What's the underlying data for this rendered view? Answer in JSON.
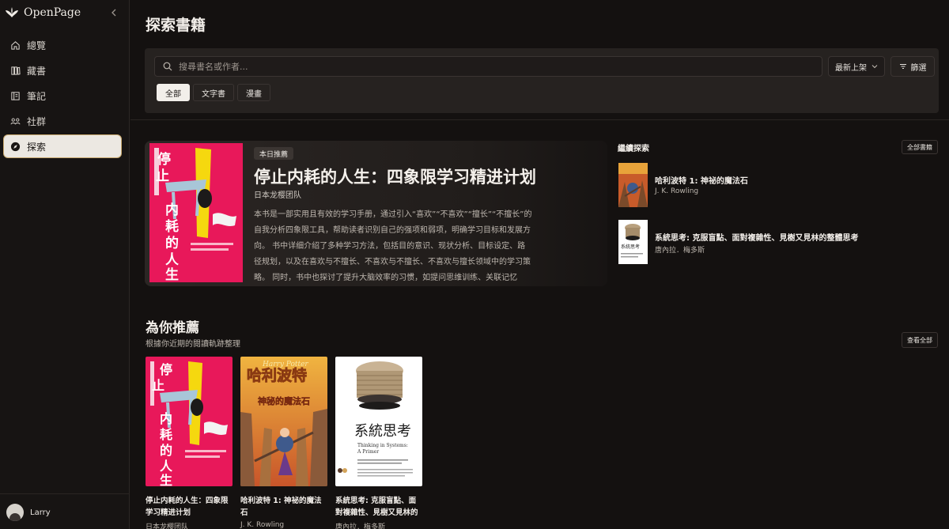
{
  "app": {
    "name": "OpenPage"
  },
  "nav": [
    {
      "label": "總覽",
      "icon": "home-icon"
    },
    {
      "label": "藏書",
      "icon": "library-icon"
    },
    {
      "label": "筆記",
      "icon": "notes-icon"
    },
    {
      "label": "社群",
      "icon": "community-icon"
    },
    {
      "label": "探索",
      "icon": "compass-icon",
      "active": true
    }
  ],
  "user": {
    "name": "Larry"
  },
  "page": {
    "title": "探索書籍"
  },
  "search": {
    "placeholder": "搜尋書名或作者..."
  },
  "sort": {
    "selected": "最新上架"
  },
  "filter": {
    "label": "篩選"
  },
  "chips": [
    {
      "label": "全部",
      "active": true
    },
    {
      "label": "文字書"
    },
    {
      "label": "漫畫"
    }
  ],
  "featured": {
    "badge": "本日推薦",
    "title": "停止内耗的人生：四象限学习精进计划",
    "author": "日本龙樱团队",
    "description": "本书是一部实用且有效的学习手册，通过引入“喜欢”“不喜欢”“擅长”“不擅长”的自我分析四象限工具，帮助读者识别自己的强项和弱项，明确学习目标和发展方向。 书中详细介绍了多种学习方法，包括目的意识、现状分析、目标设定、路径规划，以及在喜欢与不擅长、不喜欢与不擅长、不喜欢与擅长领域中的学习策略。 同时，书中也探讨了提升大脑效率的习惯，如提问思维训练、关联记忆法..."
  },
  "continue": {
    "title": "繼續探索",
    "all_label": "全部書籍",
    "items": [
      {
        "title": "哈利波特 1: 神祕的魔法石",
        "author": "J. K. Rowling"
      },
      {
        "title": "系統思考: 克服盲點、面對複雜性、見樹又見林的整體思考",
        "author": "唐內拉．梅多斯"
      }
    ]
  },
  "recommend": {
    "title": "為你推薦",
    "subtitle": "根據你近期的閱讀軌跡整理",
    "view_all": "查看全部",
    "books": [
      {
        "title": "停止内耗的人生：四象限学习精进计划",
        "author": "日本龙樱团队"
      },
      {
        "title": "哈利波特 1: 神祕的魔法石",
        "author": "J. K. Rowling"
      },
      {
        "title": "系統思考: 克服盲點、面對複雜性、見樹又見林的整體思考",
        "author": "唐內拉．梅多斯"
      }
    ]
  },
  "cover_text": {
    "book1": {
      "big": "停止内耗的人生"
    },
    "book2": {
      "brand": "Harry Potter",
      "big": "哈利波特",
      "sub": "神秘的魔法石"
    },
    "book3": {
      "big": "系統思考",
      "en": "Thinking in Systems: A Primer"
    }
  },
  "colors": {
    "accent": "#c9a96e",
    "book1_bg": "#e8185a",
    "book2_bg": "#c85b2a",
    "book3_bg": "#ffffff"
  }
}
